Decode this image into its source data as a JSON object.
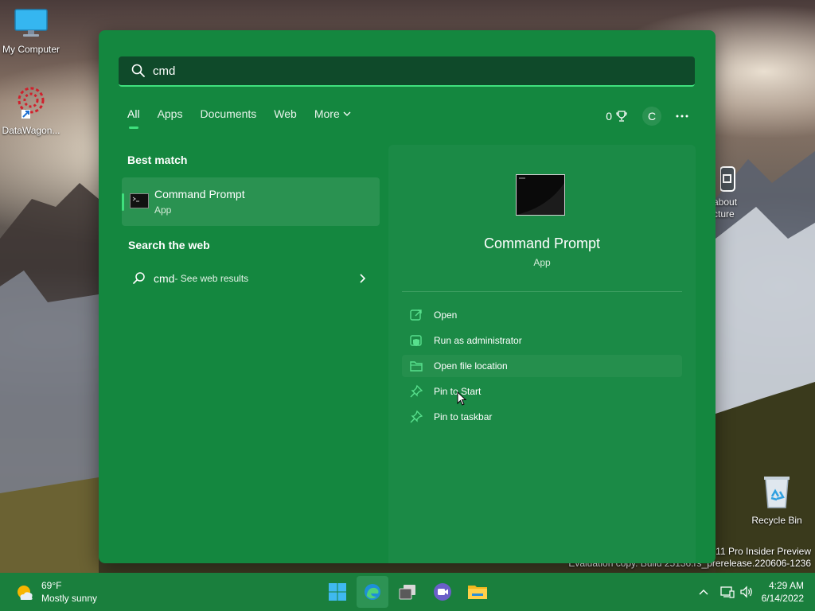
{
  "desktop": {
    "icons": [
      {
        "label": "My Computer",
        "icon": "monitor-icon"
      },
      {
        "label": "DataWagon...",
        "icon": "datawagon-icon"
      },
      {
        "label": "about cture",
        "icon": "app-icon"
      },
      {
        "label": "Recycle Bin",
        "icon": "recycle-bin-icon"
      }
    ],
    "watermark_line1": "s 11 Pro Insider Preview",
    "watermark_line2": "Evaluation copy. Build 25136.rs_prerelease.220606-1236"
  },
  "search": {
    "query": "cmd",
    "tabs": [
      "All",
      "Apps",
      "Documents",
      "Web",
      "More"
    ],
    "active_tab": "All",
    "rewards_count": "0",
    "avatar_initial": "C",
    "best_match_title": "Best match",
    "best_match": {
      "name": "Command Prompt",
      "type": "App"
    },
    "web_title": "Search the web",
    "web_result": {
      "query": "cmd",
      "suffix": " - See web results"
    },
    "detail": {
      "name": "Command Prompt",
      "type": "App",
      "actions": [
        {
          "label": "Open",
          "icon": "open-icon"
        },
        {
          "label": "Run as administrator",
          "icon": "shield-icon"
        },
        {
          "label": "Open file location",
          "icon": "folder-icon"
        },
        {
          "label": "Pin to Start",
          "icon": "pin-icon"
        },
        {
          "label": "Pin to taskbar",
          "icon": "pin-icon"
        }
      ]
    }
  },
  "taskbar": {
    "weather_temp": "69°F",
    "weather_desc": "Mostly sunny",
    "apps": [
      "start-icon",
      "edge-icon",
      "task-view-icon",
      "teams-icon",
      "file-explorer-icon"
    ],
    "time": "4:29 AM",
    "date": "6/14/2022"
  },
  "colors": {
    "panel": "#14873f",
    "accent": "#3fe07d",
    "taskbar": "#1a7f3d"
  }
}
